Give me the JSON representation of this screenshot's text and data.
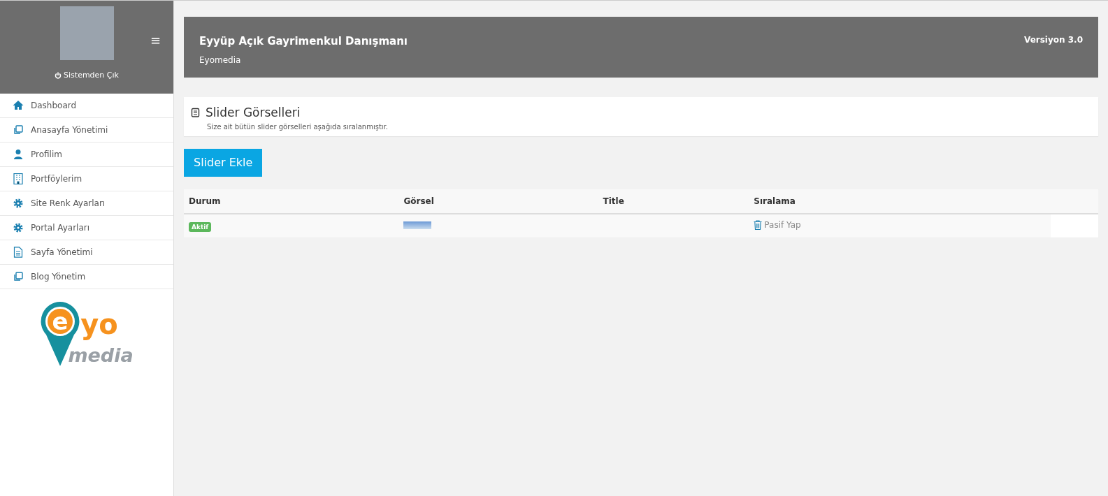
{
  "sidebar": {
    "logout": "Sistemden Çık",
    "menu_toggle": "≡",
    "items": [
      {
        "label": "Dashboard"
      },
      {
        "label": "Anasayfa Yönetimi"
      },
      {
        "label": "Profilim"
      },
      {
        "label": "Portföylerim"
      },
      {
        "label": "Site Renk Ayarları"
      },
      {
        "label": "Portal Ayarları"
      },
      {
        "label": "Sayfa Yönetimi"
      },
      {
        "label": "Blog Yönetim"
      }
    ],
    "logo": {
      "letter": "e",
      "text": "yo",
      "subtext": "media"
    }
  },
  "header": {
    "title": "Eyyüp Açık Gayrimenkul Danışmanı",
    "subtitle": "Eyomedia",
    "version": "Versiyon 3.0"
  },
  "panel": {
    "title": "Slider Görselleri",
    "description": "Size ait bütün slider görselleri aşağıda sıralanmıştır."
  },
  "add_button": "Slider Ekle",
  "table": {
    "columns": [
      "Durum",
      "Görsel",
      "Title",
      "Sıralama"
    ],
    "rows": [
      {
        "status": "Aktif",
        "action": "Pasif Yap"
      }
    ]
  }
}
